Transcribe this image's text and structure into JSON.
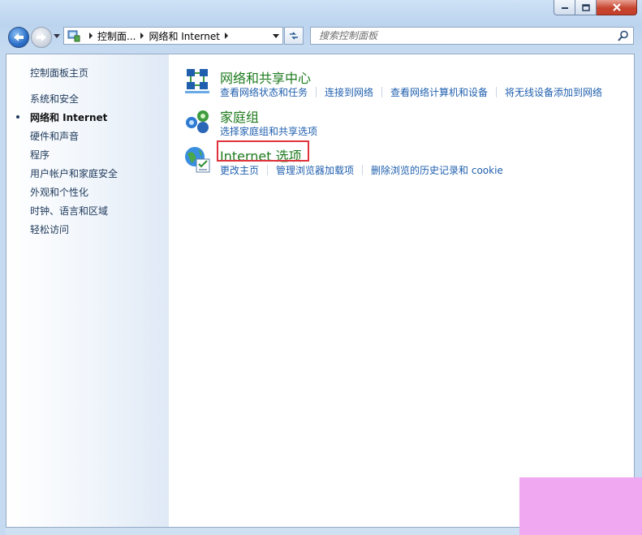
{
  "address": {
    "crumbs": [
      "控制面...",
      "网络和 Internet"
    ]
  },
  "search": {
    "placeholder": "搜索控制面板"
  },
  "sidebar": {
    "home": "控制面板主页",
    "items": [
      {
        "label": "系统和安全"
      },
      {
        "label": "网络和 Internet",
        "current": true
      },
      {
        "label": "硬件和声音"
      },
      {
        "label": "程序"
      },
      {
        "label": "用户帐户和家庭安全"
      },
      {
        "label": "外观和个性化"
      },
      {
        "label": "时钟、语言和区域"
      },
      {
        "label": "轻松访问"
      }
    ]
  },
  "categories": [
    {
      "title": "网络和共享中心",
      "icon": "network-sharing-icon",
      "links": [
        "查看网络状态和任务",
        "连接到网络",
        "查看网络计算机和设备",
        "将无线设备添加到网络"
      ]
    },
    {
      "title": "家庭组",
      "icon": "homegroup-icon",
      "links": [
        "选择家庭组和共享选项"
      ]
    },
    {
      "title": "Internet 选项",
      "icon": "internet-options-icon",
      "links": [
        "更改主页",
        "管理浏览器加载项",
        "删除浏览的历史记录和 cookie"
      ]
    }
  ],
  "colors": {
    "accent_green": "#1d7a1d",
    "link_blue": "#1f5fae",
    "highlight_red": "#e0323c"
  }
}
